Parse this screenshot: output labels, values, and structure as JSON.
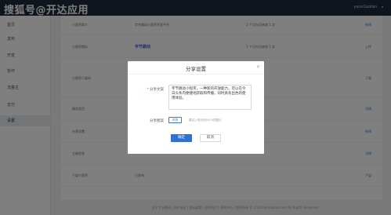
{
  "header": {
    "brand": "搜狐号@开达应用",
    "user": "yanx1aofan"
  },
  "sidebar": {
    "items": [
      {
        "label": "首页",
        "active": false
      },
      {
        "label": "发布",
        "active": false
      },
      {
        "label": "开发",
        "active": false
      },
      {
        "label": "协作",
        "active": false
      },
      {
        "label": "流量主",
        "active": false
      },
      {
        "label": "支付",
        "active": false
      },
      {
        "label": "设置",
        "active": true
      }
    ]
  },
  "table": {
    "rows": [
      {
        "c1": "小程序简介",
        "c2": "字节跳动小程序开发平台",
        "c3": "1 个月内可修改 1 次",
        "c4": "修改"
      },
      {
        "c1": "小程序图标",
        "c2": "字节跳动",
        "c3": "1 个月内可修改 1 次",
        "c4": "上传"
      },
      {
        "c1": "小程序二维码",
        "c2": "",
        "c3": "",
        "c4": "下载"
      },
      {
        "c1": "服务类目",
        "c2": "",
        "c3": "",
        "c4": "详情"
      },
      {
        "c1": "分享设置",
        "c2": "",
        "c3": "",
        "c4": "修改"
      },
      {
        "c1": "主体信息",
        "c2": "",
        "c3": "",
        "c4": "详情"
      },
      {
        "c1": "下架小程序",
        "c2": "已发布",
        "c3": "",
        "c4": "下架"
      }
    ]
  },
  "footer": {
    "text": "关于字节跳动 | 用户协议 | 隐私政策 | 联系我们 | 帮助中心 | 版权所有 © 2020 bytedance.com All Rights Reserved"
  },
  "modal": {
    "title": "分享设置",
    "close_icon": "close-icon",
    "share_text_label": "分享文案",
    "share_text_value": "字节跳动小程序，一种新的开放能力，可以在今日头条内便捷地获取和传播，同时具有出色的使用体验。",
    "share_image_label": "分享图案",
    "upload_label": "浏览",
    "upload_hint": "建议上传比例为5:4的图片",
    "confirm_label": "确定",
    "cancel_label": "取消"
  },
  "colors": {
    "topbar": "#1f2b3a",
    "primary": "#2f6fd6",
    "required": "#e54545"
  }
}
